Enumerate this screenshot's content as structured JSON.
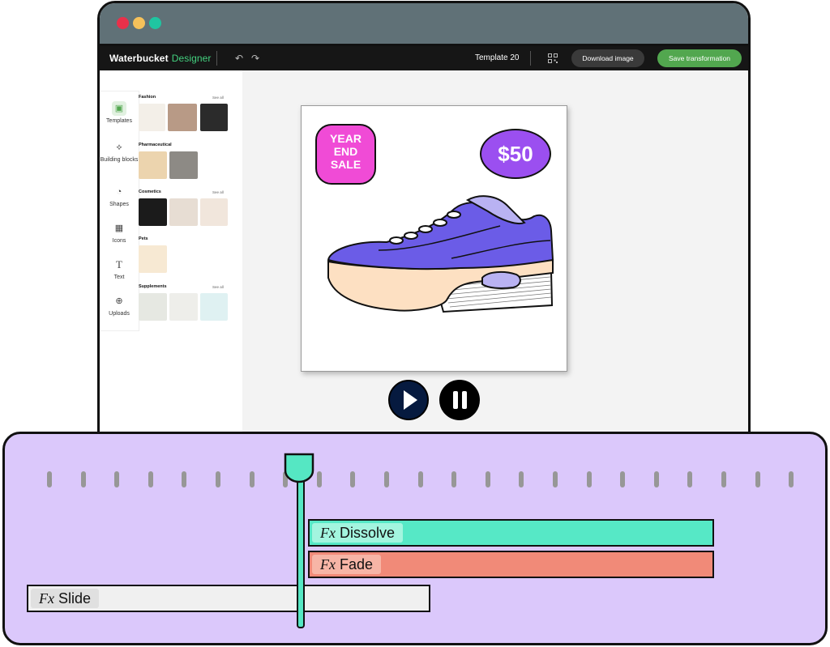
{
  "window": {
    "traffic_lights": [
      "#e9304a",
      "#f6c15a",
      "#1fc5a1"
    ]
  },
  "appbar": {
    "brand": "Waterbucket",
    "brand_suffix": "Designer",
    "template_name": "Template 20",
    "download_label": "Download image",
    "save_label": "Save transformation"
  },
  "sidebar": {
    "items": [
      {
        "label": "Templates",
        "icon": "templates-icon"
      },
      {
        "label": "Building blocks",
        "icon": "building-blocks-icon"
      },
      {
        "label": "Shapes",
        "icon": "shapes-icon"
      },
      {
        "label": "Icons",
        "icon": "icons-icon"
      },
      {
        "label": "Text",
        "icon": "text-icon"
      },
      {
        "label": "Uploads",
        "icon": "uploads-icon"
      }
    ],
    "categories": [
      {
        "title": "Fashion",
        "see_all": "See all"
      },
      {
        "title": "Pharmaceutical",
        "see_all": ""
      },
      {
        "title": "Cosmetics",
        "see_all": "See all"
      },
      {
        "title": "Pets",
        "see_all": ""
      },
      {
        "title": "Supplements",
        "see_all": "See all"
      }
    ]
  },
  "artboard": {
    "badge_lines": [
      "YEAR",
      "END",
      "SALE"
    ],
    "price": "$50",
    "colors": {
      "badge": "#f04bd6",
      "price": "#9b4ff0",
      "shoe": "#6b5ce7",
      "sole": "#fde0c2"
    }
  },
  "playback": {
    "play_icon": "play-icon",
    "pause_icon": "pause-icon"
  },
  "timeline": {
    "playhead_color": "#55e7c3",
    "tracks": [
      {
        "fx": "Fx",
        "label": "Dissolve",
        "color": "#56e8c6",
        "label_bg": "#a3f5df"
      },
      {
        "fx": "Fx",
        "label": "Fade",
        "color": "#f18a78",
        "label_bg": "#f7b5a6"
      },
      {
        "fx": "Fx",
        "label": "Slide",
        "color": "#f0f0f0",
        "label_bg": "#e0e0e0"
      }
    ]
  }
}
